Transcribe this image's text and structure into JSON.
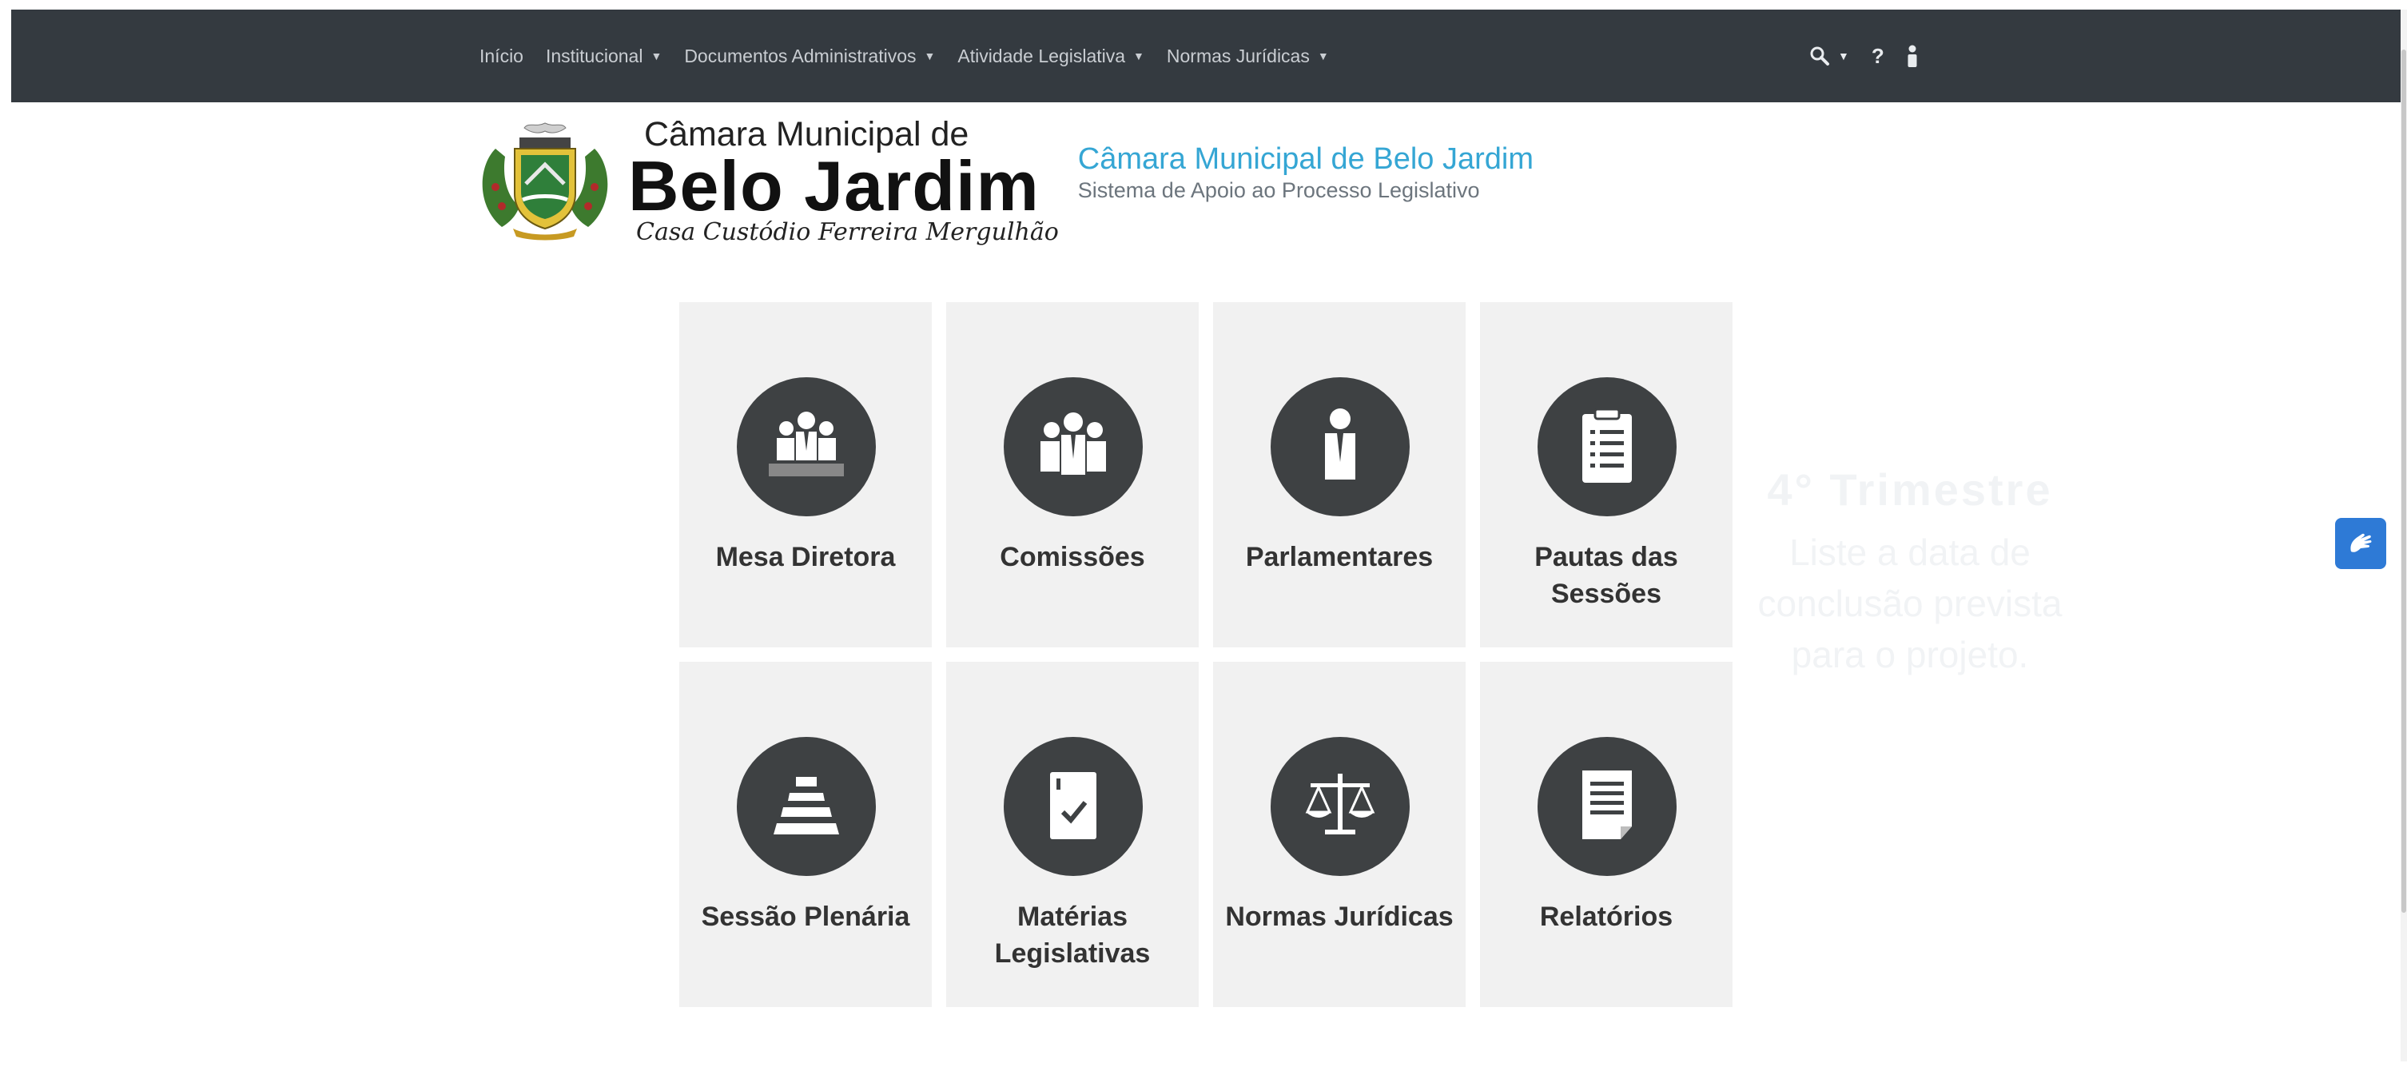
{
  "nav": {
    "items": [
      {
        "label": "Início",
        "dropdown": false
      },
      {
        "label": "Institucional",
        "dropdown": true
      },
      {
        "label": "Documentos Administrativos",
        "dropdown": true
      },
      {
        "label": "Atividade Legislativa",
        "dropdown": true
      },
      {
        "label": "Normas Jurídicas",
        "dropdown": true
      }
    ],
    "tools": {
      "help_label": "?"
    }
  },
  "logo": {
    "top": "Câmara Municipal de",
    "main": "Belo Jardim",
    "sub": "Casa Custódio Ferreira Mergulhão"
  },
  "site": {
    "title": "Câmara Municipal de Belo Jardim",
    "subtitle": "Sistema de Apoio ao Processo Legislativo"
  },
  "tiles": [
    {
      "label": "Mesa Diretora",
      "icon": "mesa-diretora-icon"
    },
    {
      "label": "Comissões",
      "icon": "comissoes-icon"
    },
    {
      "label": "Parlamentares",
      "icon": "parlamentar-icon"
    },
    {
      "label": "Pautas das Sessões",
      "icon": "clipboard-icon"
    },
    {
      "label": "Sessão Plenária",
      "icon": "plenario-icon"
    },
    {
      "label": "Matérias Legislativas",
      "icon": "document-check-icon"
    },
    {
      "label": "Normas Jurídicas",
      "icon": "scales-icon"
    },
    {
      "label": "Relatórios",
      "icon": "report-icon"
    }
  ],
  "overlay": {
    "title": "4° Trimestre",
    "text": "Liste a data de conclusão prevista para o projeto."
  },
  "colors": {
    "navbar": "#343a40",
    "tile_bg": "#f1f1f1",
    "icon_circle": "#3e4143",
    "accent": "#35a6d4",
    "a11y_button": "#2e7ad6"
  }
}
